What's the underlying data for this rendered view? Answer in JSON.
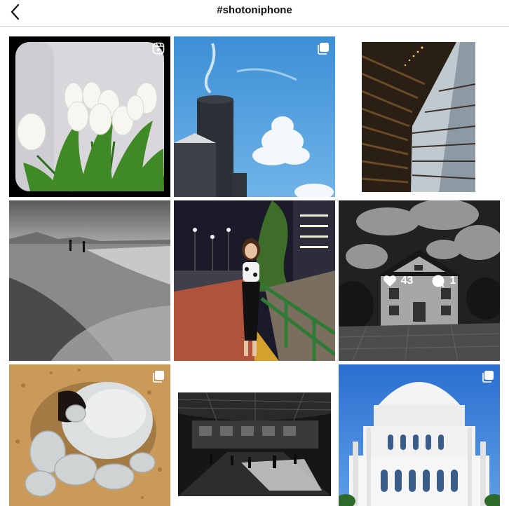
{
  "header": {
    "title": "#shotoniphone",
    "back_icon": "chevron-left-icon"
  },
  "posts": [
    {
      "subject": "white tulips",
      "badge": "reels-icon"
    },
    {
      "subject": "silos and sky",
      "badge": "carousel-icon"
    },
    {
      "subject": "building light well",
      "badge": ""
    },
    {
      "subject": "beach silhouettes",
      "badge": ""
    },
    {
      "subject": "woman by railing",
      "badge": ""
    },
    {
      "subject": "house in black and white",
      "badge": "",
      "likes": "43",
      "comments": "1"
    },
    {
      "subject": "crab in sand",
      "badge": "carousel-icon"
    },
    {
      "subject": "station interior",
      "badge": ""
    },
    {
      "subject": "white domed temple",
      "badge": "carousel-icon"
    }
  ],
  "colors": {
    "divider": "#dbdbdb",
    "title": "#111111",
    "overlay_text": "#ffffff"
  }
}
